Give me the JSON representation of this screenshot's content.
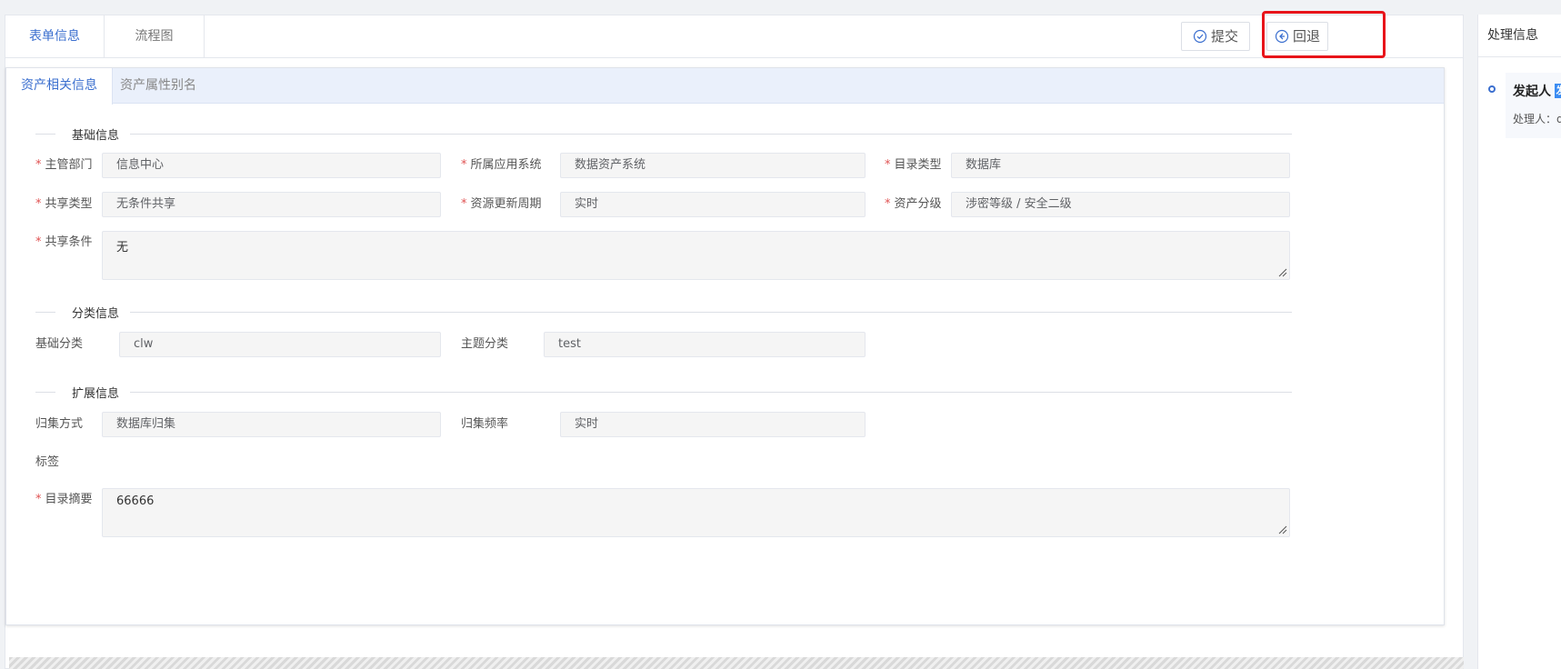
{
  "topbar": {
    "tabs": [
      {
        "label": "表单信息",
        "active": true
      },
      {
        "label": "流程图",
        "active": false
      }
    ],
    "submit_label": "提交",
    "rollback_label": "回退"
  },
  "inner_tabs": [
    {
      "label": "资产相关信息",
      "active": true
    },
    {
      "label": "资产属性别名",
      "active": false
    }
  ],
  "sections": {
    "basic": "基础信息",
    "category": "分类信息",
    "extend": "扩展信息"
  },
  "form": {
    "dept_label": "主管部门",
    "dept_value": "信息中心",
    "system_label": "所属应用系统",
    "system_value": "数据资产系统",
    "catalog_type_label": "目录类型",
    "catalog_type_value": "数据库",
    "share_type_label": "共享类型",
    "share_type_value": "无条件共享",
    "update_cycle_label": "资源更新周期",
    "update_cycle_value": "实时",
    "asset_level_label": "资产分级",
    "asset_level_value": "涉密等级 / 安全二级",
    "share_cond_label": "共享条件",
    "share_cond_value": "无",
    "base_cat_label": "基础分类",
    "base_cat_value": "clw",
    "topic_cat_label": "主题分类",
    "topic_cat_value": "test",
    "collect_method_label": "归集方式",
    "collect_method_value": "数据库归集",
    "collect_freq_label": "归集频率",
    "collect_freq_value": "实时",
    "tags_label": "标签",
    "summary_label": "目录摘要",
    "summary_value": "66666",
    "required_mark": "*"
  },
  "right_panel": {
    "title": "处理信息",
    "timeline_title": "发起人",
    "timeline_badge": "发",
    "timeline_handler": "处理人：d"
  },
  "colors": {
    "accent": "#3b6fcf",
    "highlight": "#e8141a",
    "required": "#e05252"
  }
}
